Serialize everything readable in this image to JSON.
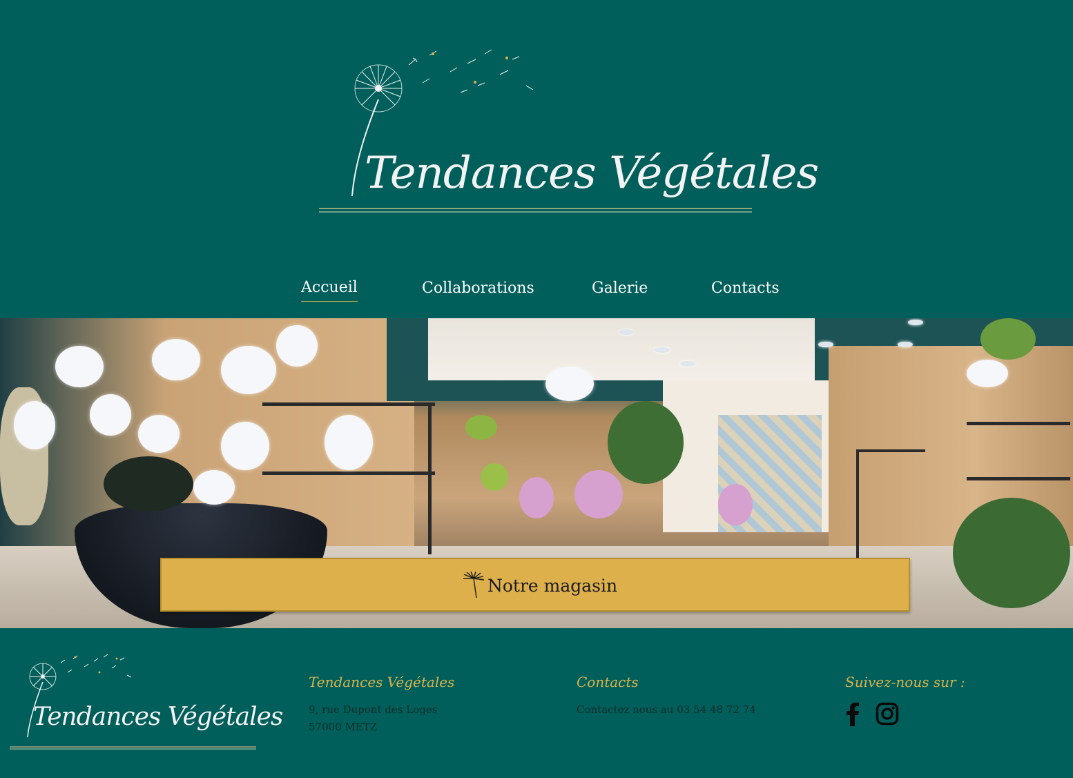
{
  "brand": {
    "name": "Tendances Végétales"
  },
  "nav": {
    "items": [
      {
        "label": "Accueil",
        "active": true
      },
      {
        "label": "Collaborations",
        "active": false
      },
      {
        "label": "Galerie",
        "active": false
      },
      {
        "label": "Contacts",
        "active": false
      }
    ]
  },
  "hero": {
    "banner_label": "Notre magasin",
    "banner_icon": "dandelion-seed-icon"
  },
  "footer": {
    "company": {
      "heading": "Tendances Végétales",
      "address_line1": "9, rue Dupont des Loges",
      "address_line2": "57000 METZ"
    },
    "contacts": {
      "heading": "Contacts",
      "text": "Contactez nous au 03 54 48 72 74"
    },
    "social": {
      "heading": "Suivez-nous sur :",
      "icons": [
        "facebook-icon",
        "instagram-icon"
      ]
    }
  },
  "colors": {
    "background": "#005f5b",
    "banner": "#ddb04c",
    "accent_gold": "#d8b24c",
    "footer_text": "#0d2b2a"
  }
}
